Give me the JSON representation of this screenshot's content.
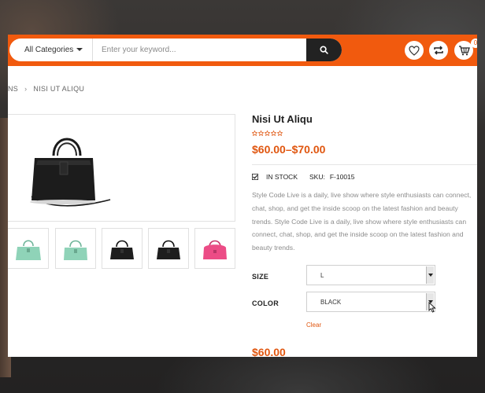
{
  "header": {
    "category_label": "All Categories",
    "search_placeholder": "Enter your keyword...",
    "cart_count": "0",
    "icons": [
      "heart-icon",
      "compare-icon",
      "cart-icon",
      "search-icon"
    ],
    "accent_color": "#f15a0e"
  },
  "breadcrumb": {
    "items": [
      "NS",
      "NISI UT ALIQU"
    ]
  },
  "product": {
    "title": "Nisi Ut Aliqu",
    "rating": 0,
    "price_range": "$60.00–$70.00",
    "stock": "IN STOCK",
    "sku_label": "SKU:",
    "sku_value": "F-10015",
    "description": "Style Code Live is a daily, live show where style enthusiasts can connect, chat, shop, and get the inside scoop on the latest fashion and beauty trends. Style Code Live is a daily, live show where style enthusiasts can connect, chat, shop, and get the inside scoop on the latest fashion and beauty trends.",
    "size_label": "SIZE",
    "size_value": "L",
    "color_label": "COLOR",
    "color_value": "BLACK",
    "clear_label": "Clear",
    "selected_price": "$60.00",
    "price_color": "#e0560f"
  },
  "gallery": {
    "thumbnails": [
      {
        "color": "#8fd3b8"
      },
      {
        "color": "#8fd3b8"
      },
      {
        "color": "#1e1e1e"
      },
      {
        "color": "#1e1e1e"
      },
      {
        "color": "#ec4c86"
      }
    ]
  }
}
